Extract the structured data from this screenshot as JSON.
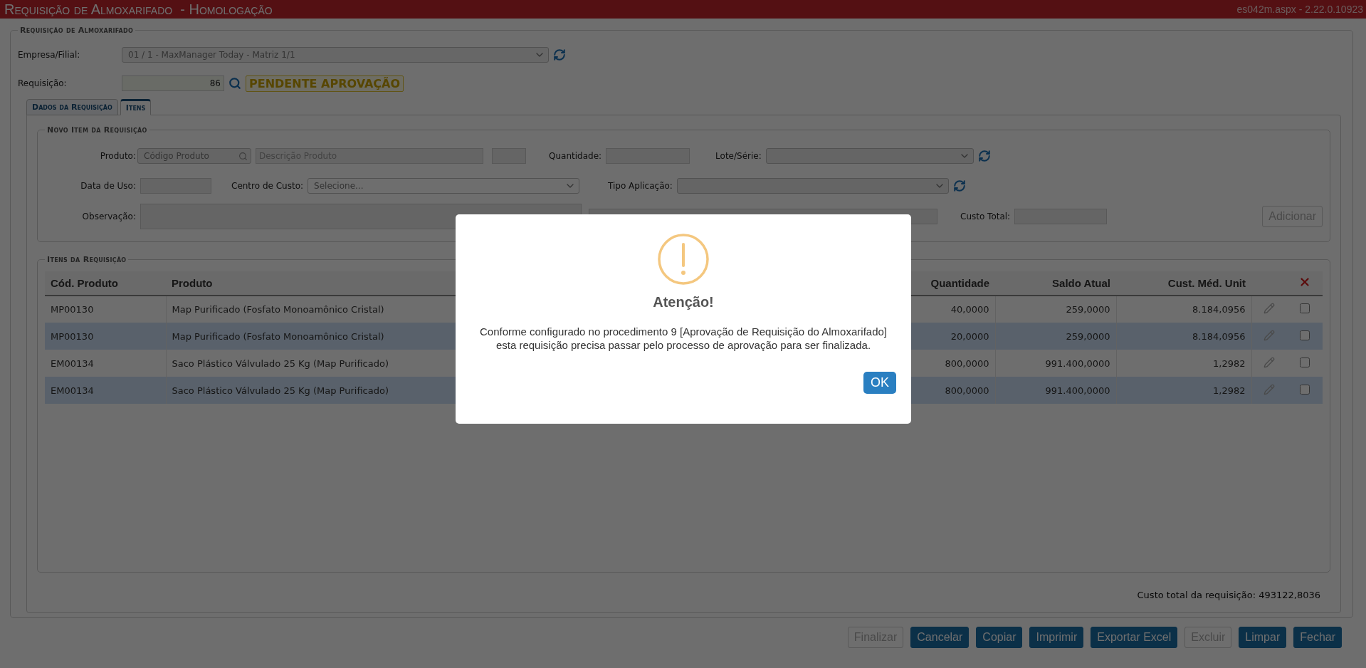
{
  "header": {
    "title": "Requisição de Almoxarifado  - Homologação",
    "version": "es042m.aspx - 2.22.0.10923"
  },
  "form": {
    "legend": "Requisição de Almoxarifado",
    "empresa_label": "Empresa/Filial:",
    "empresa_value": "01 / 1 - MaxManager Today - Matriz 1/1",
    "requisicao_label": "Requisição:",
    "requisicao_value": "86",
    "status": "PENDENTE APROVAÇÃO"
  },
  "tabs": [
    {
      "label": "Dados da Requisição",
      "selected": false
    },
    {
      "label": "Itens",
      "selected": true
    }
  ],
  "novo_item": {
    "legend": "Novo Item da Requisição",
    "produto_label": "Produto:",
    "codigo_placeholder": "Código Produto",
    "descricao_placeholder": "Descrição Produto",
    "quantidade_label": "Quantidade:",
    "lote_label": "Lote/Série:",
    "data_label": "Data de Uso:",
    "centro_label": "Centro de Custo:",
    "centro_value": "Selecione...",
    "tipo_label": "Tipo Aplicação:",
    "observacao_label": "Observação:",
    "custo_total_label": "Custo Total:",
    "add_button": {
      "label": "Adicionar",
      "disabled": true
    }
  },
  "itens": {
    "legend": "Itens da Requisição",
    "columns": [
      "Cód. Produto",
      "Produto",
      "Quantidade",
      "Saldo Atual",
      "Cust. Méd. Unit"
    ],
    "rows": [
      {
        "codigo": "MP00130",
        "produto": "Map Purificado (Fosfato Monoamônico Cristal)",
        "quantidade": "40,0000",
        "saldo": "259,0000",
        "custo": "8.184,0956",
        "checked": false
      },
      {
        "codigo": "MP00130",
        "produto": "Map Purificado (Fosfato Monoamônico Cristal)",
        "quantidade": "20,0000",
        "saldo": "259,0000",
        "custo": "8.184,0956",
        "checked": false
      },
      {
        "codigo": "EM00134",
        "produto": "Saco Plástico Válvulado 25 Kg (Map Purificado)",
        "quantidade": "800,0000",
        "saldo": "991.400,0000",
        "custo": "1,2982",
        "checked": false
      },
      {
        "codigo": "EM00134",
        "produto": "Saco Plástico Válvulado 25 Kg (Map Purificado)",
        "quantidade": "800,0000",
        "saldo": "991.400,0000",
        "custo": "1,2982",
        "checked": false
      }
    ],
    "total": "Custo total da requisição: 493122,8036"
  },
  "buttons": [
    {
      "label": "Finalizar",
      "disabled": true
    },
    {
      "label": "Cancelar",
      "disabled": false
    },
    {
      "label": "Copiar",
      "disabled": false
    },
    {
      "label": "Imprimir",
      "disabled": false
    },
    {
      "label": "Exportar Excel",
      "disabled": false
    },
    {
      "label": "Excluir",
      "disabled": true
    },
    {
      "label": "Limpar",
      "disabled": false
    },
    {
      "label": "Fechar",
      "disabled": false
    }
  ],
  "dialog": {
    "title": "Atenção!",
    "message_lines": [
      "Conforme configurado no procedimento 9 [Aprovação de Requisição do Almoxarifado]",
      "esta requisição precisa passar pelo processo de aprovação para ser finalizada."
    ],
    "ok": "OK"
  }
}
